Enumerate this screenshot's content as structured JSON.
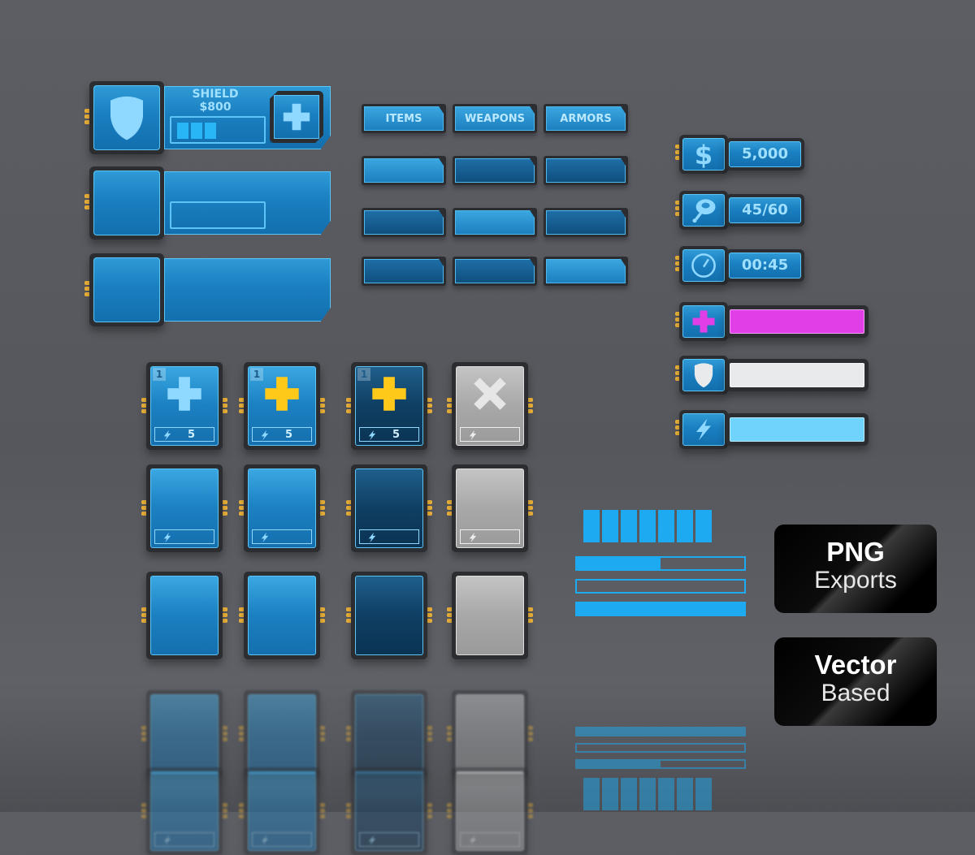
{
  "shop_item": {
    "title": "SHIELD",
    "price": "$800",
    "level_segments": 3,
    "add_icon": "plus-icon",
    "item_icon": "shield-icon"
  },
  "tabs": [
    "ITEMS",
    "WEAPONS",
    "ARMORS"
  ],
  "stats": [
    {
      "icon": "dollar-icon",
      "value": "5,000"
    },
    {
      "icon": "meat-icon",
      "value": "45/60"
    },
    {
      "icon": "stopwatch-icon",
      "value": "00:45"
    }
  ],
  "status_bars": [
    {
      "icon": "health-plus-icon",
      "color": "#e03ee6",
      "fill": 1.0
    },
    {
      "icon": "shield-icon",
      "color": "#e8eaec",
      "fill": 1.0
    },
    {
      "icon": "lightning-icon",
      "color": "#6fd3fb",
      "fill": 1.0
    }
  ],
  "cards": {
    "count": "1",
    "cost": "5",
    "variants": [
      {
        "style": "blue",
        "icon_color": "#8fd8ff",
        "icon": "plus-icon"
      },
      {
        "style": "blue",
        "icon_color": "#ffc91a",
        "icon": "plus-icon"
      },
      {
        "style": "dark",
        "icon_color": "#ffc91a",
        "icon": "plus-icon"
      },
      {
        "style": "gray",
        "icon_color": "#e6e6e6",
        "icon": "close-icon"
      }
    ]
  },
  "progress": {
    "segments": 7,
    "bars": [
      0.5,
      0,
      1
    ]
  },
  "badges": [
    {
      "bold": "PNG",
      "light": "Exports"
    },
    {
      "bold": "Vector",
      "light": "Based"
    }
  ],
  "colors": {
    "accent": "#1eaaf1",
    "plug": "#f4b73a"
  }
}
